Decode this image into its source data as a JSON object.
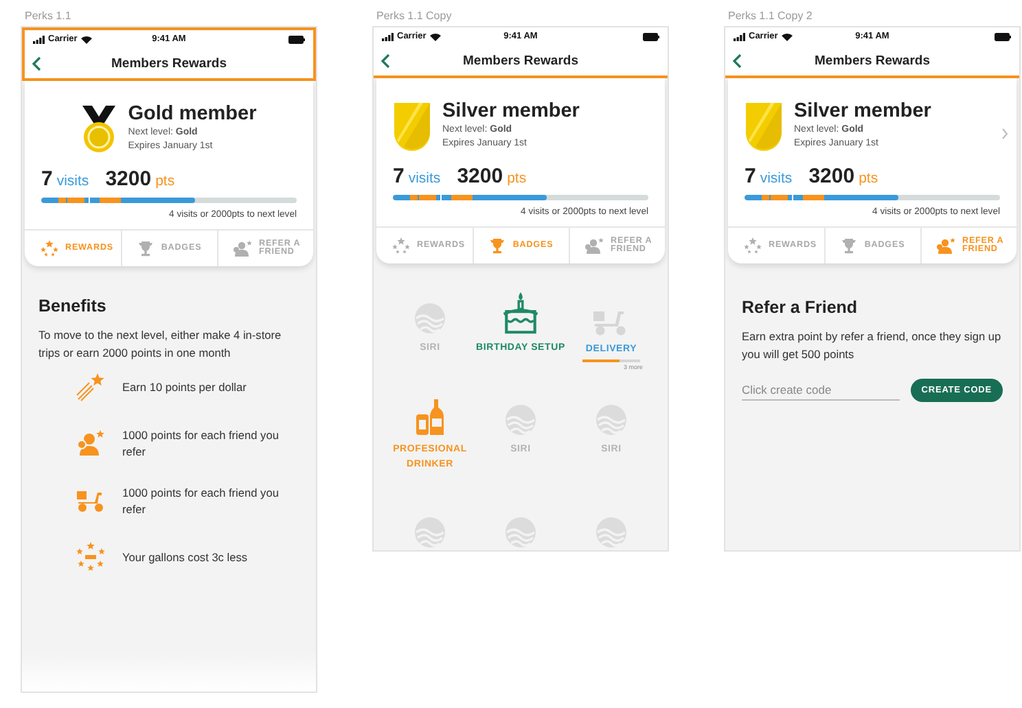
{
  "artboards": [
    {
      "label": "Perks 1.1",
      "selected": true,
      "status": {
        "carrier": "Carrier",
        "time": "9:41 AM"
      },
      "nav_title": "Members Rewards",
      "member": {
        "kind": "medal",
        "title": "Gold member",
        "next_level": "Next level: **Gold**",
        "expires": "Expires January 1st",
        "has_chevron": false,
        "visits": "7",
        "visits_unit": "visits",
        "points": "3200",
        "points_unit": "pts",
        "level": 0.6,
        "note": "4 visits or 2000pts to next level"
      },
      "tabs": [
        {
          "label": "REWARDS",
          "selected": true
        },
        {
          "label": "BADGES",
          "selected": false
        },
        {
          "label": "REFER A FRIEND",
          "selected": false
        }
      ],
      "content": {
        "kind": "benefits",
        "title": "Benefits",
        "intro": "To move to the next level, either make 4 in-store trips or earn 2000 points in one month",
        "items": [
          {
            "text": "Earn 10 points per dollar"
          },
          {
            "text": "1000 points for each friend you refer"
          },
          {
            "text": "1000 points for each friend you refer"
          },
          {
            "text": "Your gallons cost 3c less"
          }
        ]
      }
    },
    {
      "label": "Perks 1.1 Copy",
      "selected": false,
      "status": {
        "carrier": "Carrier",
        "time": "9:41 AM"
      },
      "nav_title": "Members Rewards",
      "member": {
        "kind": "shield",
        "title": "Silver member",
        "next_level": "Next level: **Gold**",
        "expires": "Expires January 1st",
        "has_chevron": false,
        "visits": "7",
        "visits_unit": "visits",
        "points": "3200",
        "points_unit": "pts",
        "level": 0.6,
        "note": "4 visits or 2000pts to next level"
      },
      "tabs": [
        {
          "label": "REWARDS",
          "selected": false
        },
        {
          "label": "BADGES",
          "selected": true
        },
        {
          "label": "REFER A FRIEND",
          "selected": false
        }
      ],
      "content": {
        "kind": "badges",
        "items": [
          {
            "kind": "locked",
            "label": "SIRI",
            "color": "#b4b4b4"
          },
          {
            "kind": "birthday",
            "label": "BIRTHDAY SETUP",
            "color": "#1f8a65"
          },
          {
            "kind": "delivery",
            "label": "DELIVERY",
            "color": "#3a9ad9",
            "level": 0.65,
            "note": "3 more"
          },
          {
            "kind": "drinker",
            "label": "PROFESIONAL DRINKER",
            "color": "#f7931e"
          },
          {
            "kind": "locked",
            "label": "SIRI",
            "color": "#b4b4b4"
          },
          {
            "kind": "locked",
            "label": "SIRI",
            "color": "#b4b4b4"
          },
          {
            "kind": "locked"
          },
          {
            "kind": "locked"
          },
          {
            "kind": "locked"
          }
        ]
      }
    },
    {
      "label": "Perks 1.1 Copy 2",
      "selected": false,
      "status": {
        "carrier": "Carrier",
        "time": "9:41 AM"
      },
      "nav_title": "Members Rewards",
      "member": {
        "kind": "shield",
        "title": "Silver member",
        "next_level": "Next level: **Gold**",
        "expires": "Expires January 1st",
        "has_chevron": true,
        "visits": "7",
        "visits_unit": "visits",
        "points": "3200",
        "points_unit": "pts",
        "level": 0.6,
        "note": "4 visits or 2000pts to next level"
      },
      "tabs": [
        {
          "label": "REWARDS",
          "selected": false
        },
        {
          "label": "BADGES",
          "selected": false
        },
        {
          "label": "REFER A FRIEND",
          "selected": true
        }
      ],
      "content": {
        "kind": "refer",
        "title": "Refer a Friend",
        "text": "Earn extra point by refer a friend, once they sign up you will get 500 points",
        "placeholder": "Click create code",
        "button": "CREATE CODE"
      }
    }
  ]
}
